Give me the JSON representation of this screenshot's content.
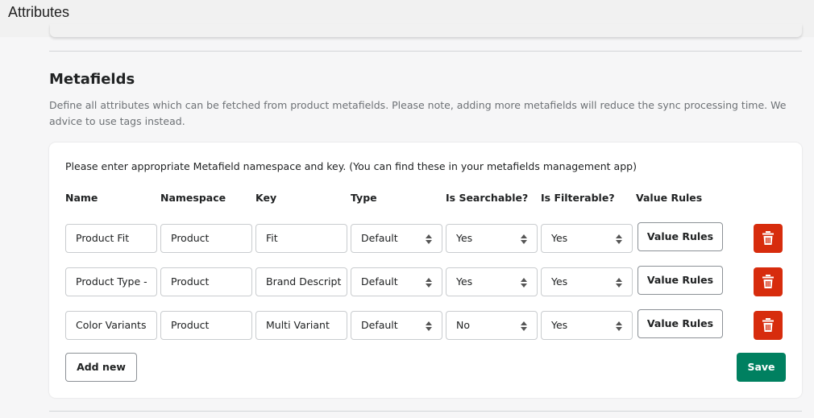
{
  "header": {
    "title": "Attributes"
  },
  "section": {
    "title": "Metafields",
    "description": "Define all attributes which can be fetched from product metafields. Please note, adding more metafields will reduce the sync processing time. We advice to use tags instead."
  },
  "card": {
    "intro": "Please enter appropriate Metafield namespace and key. (You can find these in your metafields management app)",
    "columns": [
      "Name",
      "Namespace",
      "Key",
      "Type",
      "Is Searchable?",
      "Is Filterable?",
      "Value Rules"
    ],
    "rows": [
      {
        "name": "Product Fit",
        "namespace": "Product",
        "key": "Fit",
        "type": "Default",
        "searchable": "Yes",
        "filterable": "Yes",
        "value_rules": "Value Rules"
      },
      {
        "name": "Product Type -",
        "namespace": "Product",
        "key": "Brand Descript",
        "type": "Default",
        "searchable": "Yes",
        "filterable": "Yes",
        "value_rules": "Value Rules"
      },
      {
        "name": "Color Variants",
        "namespace": "Product",
        "key": "Multi Variant",
        "type": "Default",
        "searchable": "No",
        "filterable": "Yes",
        "value_rules": "Value Rules"
      }
    ],
    "add_label": "Add new",
    "save_label": "Save"
  },
  "colors": {
    "save": "#008060",
    "delete": "#d72c0d"
  },
  "icons": {
    "delete": "trash-icon"
  }
}
